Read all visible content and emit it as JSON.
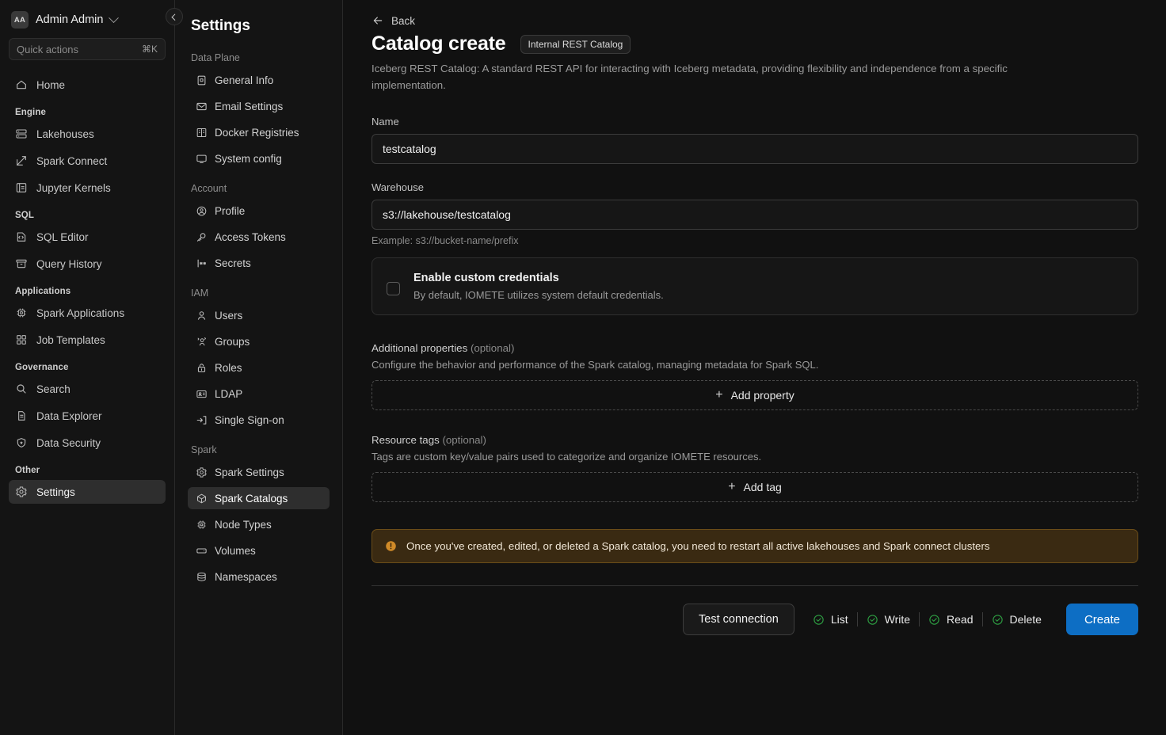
{
  "leftnav": {
    "user": {
      "initials": "AA",
      "name": "Admin Admin"
    },
    "quick_actions": {
      "placeholder": "Quick actions",
      "shortcut": "⌘K"
    },
    "home": {
      "label": "Home",
      "icon": "home-icon"
    },
    "groups": [
      {
        "label": "Engine",
        "items": [
          {
            "label": "Lakehouses",
            "icon": "lakehouse-icon"
          },
          {
            "label": "Spark Connect",
            "icon": "spark-connect-icon"
          },
          {
            "label": "Jupyter Kernels",
            "icon": "jupyter-kernels-icon"
          }
        ]
      },
      {
        "label": "SQL",
        "items": [
          {
            "label": "SQL Editor",
            "icon": "code-icon"
          },
          {
            "label": "Query History",
            "icon": "history-icon"
          }
        ]
      },
      {
        "label": "Applications",
        "items": [
          {
            "label": "Spark Applications",
            "icon": "chip-icon"
          },
          {
            "label": "Job Templates",
            "icon": "grid-icon"
          }
        ]
      },
      {
        "label": "Governance",
        "items": [
          {
            "label": "Search",
            "icon": "search-icon"
          },
          {
            "label": "Data Explorer",
            "icon": "document-icon"
          },
          {
            "label": "Data Security",
            "icon": "shield-icon"
          }
        ]
      },
      {
        "label": "Other",
        "items": [
          {
            "label": "Settings",
            "icon": "gear-icon",
            "active": true
          }
        ]
      }
    ]
  },
  "settings": {
    "title": "Settings",
    "groups": [
      {
        "label": "Data Plane",
        "items": [
          {
            "label": "General Info",
            "icon": "note-icon"
          },
          {
            "label": "Email Settings",
            "icon": "mail-icon"
          },
          {
            "label": "Docker Registries",
            "icon": "registry-icon"
          },
          {
            "label": "System config",
            "icon": "monitor-icon"
          }
        ]
      },
      {
        "label": "Account",
        "items": [
          {
            "label": "Profile",
            "icon": "user-circle-icon"
          },
          {
            "label": "Access Tokens",
            "icon": "key-icon"
          },
          {
            "label": "Secrets",
            "icon": "secrets-icon"
          }
        ]
      },
      {
        "label": "IAM",
        "items": [
          {
            "label": "Users",
            "icon": "user-icon"
          },
          {
            "label": "Groups",
            "icon": "users-icon"
          },
          {
            "label": "Roles",
            "icon": "lock-icon"
          },
          {
            "label": "LDAP",
            "icon": "id-card-icon"
          },
          {
            "label": "Single Sign-on",
            "icon": "sign-in-icon"
          }
        ]
      },
      {
        "label": "Spark",
        "items": [
          {
            "label": "Spark Settings",
            "icon": "gear-icon"
          },
          {
            "label": "Spark Catalogs",
            "icon": "cube-icon",
            "active": true
          },
          {
            "label": "Node Types",
            "icon": "chip-icon"
          },
          {
            "label": "Volumes",
            "icon": "volume-icon"
          },
          {
            "label": "Namespaces",
            "icon": "database-icon"
          }
        ]
      }
    ]
  },
  "main": {
    "back_label": "Back",
    "title": "Catalog create",
    "badge": "Internal REST Catalog",
    "subtitle": "Iceberg REST Catalog: A standard REST API for interacting with Iceberg metadata, providing flexibility and independence from a specific implementation.",
    "name_field": {
      "label": "Name",
      "value": "testcatalog",
      "placeholder": "Name"
    },
    "warehouse_field": {
      "label": "Warehouse",
      "value": "s3://lakehouse/testcatalog",
      "placeholder": "s3://bucket-name/prefix",
      "hint": "Example: s3://bucket-name/prefix"
    },
    "credentials": {
      "title": "Enable custom credentials",
      "description": "By default, IOMETE utilizes system default credentials.",
      "checked": false
    },
    "additional_properties": {
      "label": "Additional properties",
      "optional": "(optional)",
      "description": "Configure the behavior and performance of the Spark catalog, managing metadata for Spark SQL.",
      "add_label": "Add property"
    },
    "resource_tags": {
      "label": "Resource tags",
      "optional": "(optional)",
      "description": "Tags are custom key/value pairs used to categorize and organize IOMETE resources.",
      "add_label": "Add tag"
    },
    "warning": "Once you've created, edited, or deleted a Spark catalog, you need to restart all active lakehouses and Spark connect clusters",
    "footer": {
      "test_label": "Test connection",
      "statuses": [
        {
          "label": "List"
        },
        {
          "label": "Write"
        },
        {
          "label": "Read"
        },
        {
          "label": "Delete"
        }
      ],
      "create_label": "Create"
    }
  },
  "colors": {
    "accent": "#0d6ec4",
    "success": "#2ea043",
    "warning": "#d08a28",
    "bg": "#111111",
    "panel": "#141414"
  }
}
